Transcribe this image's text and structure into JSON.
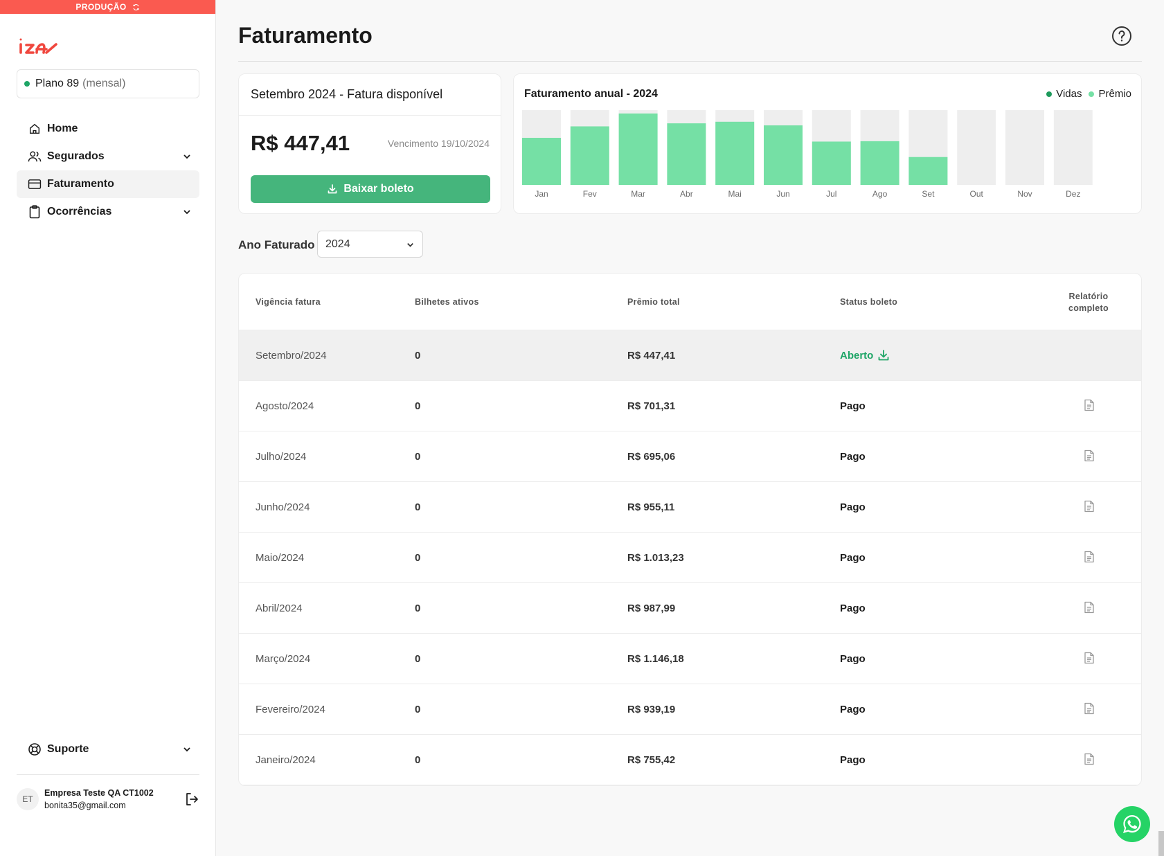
{
  "environment": {
    "label": "PRODUÇÃO"
  },
  "brand": {
    "logo_text": "iza",
    "accent": "#f0473e"
  },
  "plan": {
    "name": "Plano 89",
    "period": "(mensal)",
    "status_color": "#1ea566"
  },
  "sidebar": {
    "items": [
      {
        "label": "Home",
        "icon": "home-icon",
        "active": false,
        "expandable": false
      },
      {
        "label": "Segurados",
        "icon": "users-icon",
        "active": false,
        "expandable": true
      },
      {
        "label": "Faturamento",
        "icon": "card-icon",
        "active": true,
        "expandable": false
      },
      {
        "label": "Ocorrências",
        "icon": "clipboard-icon",
        "active": false,
        "expandable": true
      }
    ],
    "support_label": "Suporte"
  },
  "user": {
    "initials": "ET",
    "company": "Empresa Teste QA CT1002",
    "email": "bonita35@gmail.com"
  },
  "page": {
    "title": "Faturamento"
  },
  "invoice": {
    "header": "Setembro 2024 - Fatura disponível",
    "amount": "R$ 447,41",
    "due": "Vencimento 19/10/2024",
    "download_label": "Baixar boleto"
  },
  "chart_data": {
    "type": "bar",
    "title": "Faturamento anual - 2024",
    "categories": [
      "Jan",
      "Fev",
      "Mar",
      "Abr",
      "Mai",
      "Jun",
      "Jul",
      "Ago",
      "Set",
      "Out",
      "Nov",
      "Dez"
    ],
    "series": [
      {
        "name": "Prêmio",
        "values": [
          755.42,
          939.19,
          1146.18,
          987.99,
          1013.23,
          955.11,
          695.06,
          701.31,
          447.41,
          0,
          0,
          0
        ],
        "color": "#75e0a5"
      }
    ],
    "legend": [
      {
        "name": "Vidas",
        "color": "#1e9a5c"
      },
      {
        "name": "Prêmio",
        "color": "#75e0a5"
      }
    ],
    "track_color": "#eeeeee",
    "ylim": [
      0,
      1200
    ],
    "legend_position": "top-right",
    "grid": false
  },
  "filter": {
    "label": "Ano Faturado",
    "selected": "2024"
  },
  "table": {
    "headers": [
      "Vigência fatura",
      "Bilhetes ativos",
      "Prêmio total",
      "Status boleto"
    ],
    "report_header_line1": "Relatório",
    "report_header_line2": "completo",
    "rows": [
      {
        "period": "Setembro/2024",
        "tickets": "0",
        "premium": "R$ 447,41",
        "status": "Aberto"
      },
      {
        "period": "Agosto/2024",
        "tickets": "0",
        "premium": "R$ 701,31",
        "status": "Pago"
      },
      {
        "period": "Julho/2024",
        "tickets": "0",
        "premium": "R$ 695,06",
        "status": "Pago"
      },
      {
        "period": "Junho/2024",
        "tickets": "0",
        "premium": "R$ 955,11",
        "status": "Pago"
      },
      {
        "period": "Maio/2024",
        "tickets": "0",
        "premium": "R$ 1.013,23",
        "status": "Pago"
      },
      {
        "period": "Abril/2024",
        "tickets": "0",
        "premium": "R$ 987,99",
        "status": "Pago"
      },
      {
        "period": "Março/2024",
        "tickets": "0",
        "premium": "R$ 1.146,18",
        "status": "Pago"
      },
      {
        "period": "Fevereiro/2024",
        "tickets": "0",
        "premium": "R$ 939,19",
        "status": "Pago"
      },
      {
        "period": "Janeiro/2024",
        "tickets": "0",
        "premium": "R$ 755,42",
        "status": "Pago"
      }
    ]
  },
  "colors": {
    "success": "#1ea566",
    "button": "#45b57c"
  }
}
